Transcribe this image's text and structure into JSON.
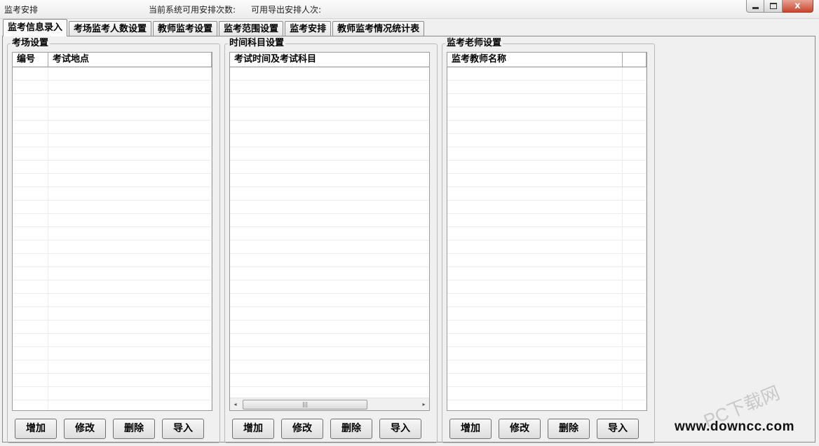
{
  "window": {
    "title": "监考安排",
    "available_times_label": "当前系统可用安排次数:",
    "available_export_label": "可用导出安排人次:",
    "close_glyph": "x"
  },
  "tabs": [
    {
      "label": "监考信息录入",
      "active": true
    },
    {
      "label": "考场监考人数设置"
    },
    {
      "label": "教师监考设置"
    },
    {
      "label": "监考范围设置"
    },
    {
      "label": "监考安排"
    },
    {
      "label": "教师监考情况统计表"
    }
  ],
  "groups": {
    "venue": {
      "title": "考场设置",
      "columns": [
        "编号",
        "考试地点"
      ]
    },
    "time": {
      "title": "时间科目设置",
      "columns": [
        "考试时间及考试科目"
      ]
    },
    "teacher": {
      "title": "监考老师设置",
      "columns": [
        "监考教师名称",
        ""
      ]
    }
  },
  "buttons": {
    "add": "增加",
    "edit": "修改",
    "delete": "删除",
    "import": "导入"
  },
  "scrollbar": {
    "left": "◂",
    "right": "▸",
    "grip": "|||"
  },
  "watermark": {
    "site": "www.downcc.com",
    "logo": "PC下载网"
  }
}
